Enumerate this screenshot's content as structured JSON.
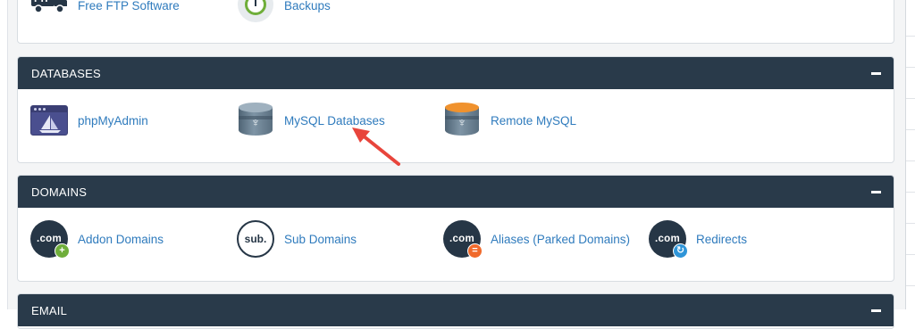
{
  "top_partial_panel": {
    "items": [
      {
        "label": "Free FTP Software",
        "icon": "ftp-truck-icon"
      },
      {
        "label": "Backups",
        "icon": "backups-icon"
      }
    ]
  },
  "databases": {
    "title": "DATABASES",
    "items": [
      {
        "label": "phpMyAdmin",
        "icon": "phpmyadmin-icon"
      },
      {
        "label": "MySQL Databases",
        "icon": "mysql-databases-icon"
      },
      {
        "label": "Remote MySQL",
        "icon": "remote-mysql-icon"
      }
    ]
  },
  "domains": {
    "title": "DOMAINS",
    "items": [
      {
        "label": "Addon Domains",
        "icon_text": ".com",
        "badge": "+",
        "badge_color": "#6fae3a"
      },
      {
        "label": "Sub Domains",
        "icon_text": "sub."
      },
      {
        "label": "Aliases (Parked Domains)",
        "icon_text": ".com",
        "badge": "=",
        "badge_color": "#f06a2c"
      },
      {
        "label": "Redirects",
        "icon_text": ".com",
        "badge": "↻",
        "badge_color": "#2f95d8"
      }
    ]
  },
  "email": {
    "title": "EMAIL"
  },
  "colors": {
    "header_bg": "#293a4a",
    "link": "#2f7bbd",
    "annotation_arrow": "#e8453c"
  }
}
